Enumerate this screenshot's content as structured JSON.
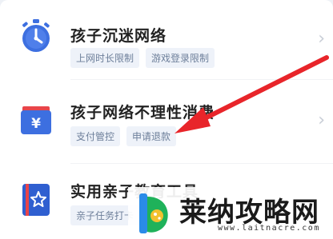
{
  "items": [
    {
      "title": "孩子沉迷网络",
      "tags": [
        "上网时长限制",
        "游戏登录限制"
      ],
      "icon": "stopwatch-icon",
      "accent": "#3d6fe0"
    },
    {
      "title": "孩子网络不理性消费",
      "tags": [
        "支付管控",
        "申请退款"
      ],
      "icon": "yuan-wallet-icon",
      "accent": "#3d6fe0"
    },
    {
      "title": "实用亲子教育工具",
      "tags": [
        "亲子任务打卡"
      ],
      "icon": "star-book-icon",
      "accent": "#2f5fd0"
    }
  ],
  "annotation": {
    "icon": "red-arrow-icon",
    "color": "#e8252a"
  },
  "watermark": {
    "name": "莱纳攻略网",
    "url": "www.laitnacre.com"
  }
}
